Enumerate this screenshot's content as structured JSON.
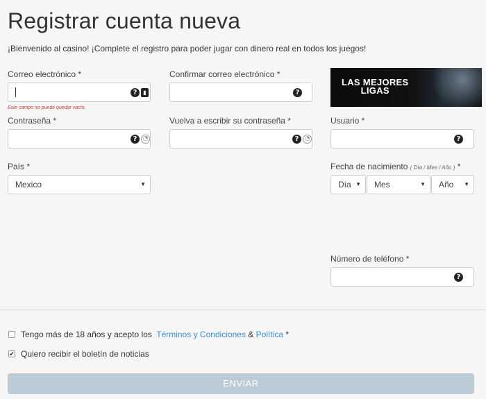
{
  "page": {
    "title": "Registrar cuenta nueva",
    "subtitle": "¡Bienvenido al casino! ¡Complete el registro para poder jugar con dinero real en todos los juegos!"
  },
  "fields": {
    "email": {
      "label": "Correo electrónico *",
      "value": "",
      "error": "Este campo no puede quedar vacío."
    },
    "confirm_email": {
      "label": "Confirmar correo electrónico *",
      "value": ""
    },
    "password": {
      "label": "Contraseña *",
      "value": ""
    },
    "confirm_password": {
      "label": "Vuelva a escribir su contraseña *",
      "value": ""
    },
    "username": {
      "label": "Usuario *",
      "value": ""
    },
    "country": {
      "label": "País *",
      "selected": "Mexico"
    },
    "birthdate": {
      "label": "Fecha de nacimiento",
      "hint": "( Día / Mes / Año )",
      "required": "*",
      "day": "Día",
      "month": "Mes",
      "year": "Año"
    },
    "phone": {
      "label": "Número de teléfono *",
      "value": ""
    }
  },
  "icons": {
    "help": "?",
    "help_icon_name": "question-circle-icon"
  },
  "banner": {
    "line1": "LAS MEJORES",
    "line2": "LIGAS"
  },
  "consent": {
    "terms_prefix": "Tengo más de 18 años y acepto los",
    "terms_link": "Términos y Condiciones",
    "amp": "&",
    "policy_link": "Política",
    "required": "*",
    "terms_checked": false,
    "newsletter_label": "Quiero recibir el boletín de noticias",
    "newsletter_checked": true
  },
  "submit": {
    "label": "ENVIAR"
  },
  "colors": {
    "accent_link": "#3a8fd0",
    "error": "#c0392b",
    "submit_bg": "#bccbd6"
  }
}
